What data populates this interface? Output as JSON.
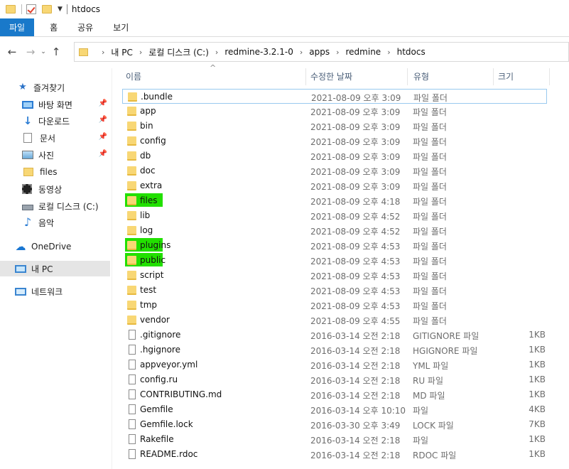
{
  "window": {
    "title": "htdocs"
  },
  "ribbon": {
    "tabs": [
      "파일",
      "홈",
      "공유",
      "보기"
    ]
  },
  "address": {
    "breadcrumbs": [
      "내 PC",
      "로컬 디스크 (C:)",
      "redmine-3.2.1-0",
      "apps",
      "redmine",
      "htdocs"
    ]
  },
  "sidebar": {
    "items": [
      {
        "label": "즐겨찾기",
        "icon": "star-icon",
        "pinned": false
      },
      {
        "label": "바탕 화면",
        "icon": "desktop-icon",
        "pinned": true
      },
      {
        "label": "다운로드",
        "icon": "download-icon",
        "pinned": true
      },
      {
        "label": "문서",
        "icon": "document-icon",
        "pinned": true
      },
      {
        "label": "사진",
        "icon": "pictures-icon",
        "pinned": true
      },
      {
        "label": "files",
        "icon": "folder-icon",
        "pinned": false
      },
      {
        "label": "동영상",
        "icon": "video-icon",
        "pinned": false
      },
      {
        "label": "로컬 디스크 (C:)",
        "icon": "drive-icon",
        "pinned": false
      },
      {
        "label": "음악",
        "icon": "music-icon",
        "pinned": false
      },
      {
        "label": "OneDrive",
        "icon": "onedrive-icon",
        "pinned": false
      },
      {
        "label": "내 PC",
        "icon": "pc-icon",
        "pinned": false,
        "selected": true
      },
      {
        "label": "네트워크",
        "icon": "network-icon",
        "pinned": false
      }
    ]
  },
  "columns": {
    "name": "이름",
    "modified": "수정한 날짜",
    "type": "유형",
    "size": "크기"
  },
  "files": [
    {
      "name": ".bundle",
      "date": "2021-08-09 오후 3:09",
      "type": "파일 폴더",
      "size": "",
      "kind": "folder",
      "focused": true
    },
    {
      "name": "app",
      "date": "2021-08-09 오후 3:09",
      "type": "파일 폴더",
      "size": "",
      "kind": "folder"
    },
    {
      "name": "bin",
      "date": "2021-08-09 오후 3:09",
      "type": "파일 폴더",
      "size": "",
      "kind": "folder"
    },
    {
      "name": "config",
      "date": "2021-08-09 오후 3:09",
      "type": "파일 폴더",
      "size": "",
      "kind": "folder"
    },
    {
      "name": "db",
      "date": "2021-08-09 오후 3:09",
      "type": "파일 폴더",
      "size": "",
      "kind": "folder"
    },
    {
      "name": "doc",
      "date": "2021-08-09 오후 3:09",
      "type": "파일 폴더",
      "size": "",
      "kind": "folder"
    },
    {
      "name": "extra",
      "date": "2021-08-09 오후 3:09",
      "type": "파일 폴더",
      "size": "",
      "kind": "folder"
    },
    {
      "name": "files",
      "date": "2021-08-09 오후 4:18",
      "type": "파일 폴더",
      "size": "",
      "kind": "folder",
      "highlight": true
    },
    {
      "name": "lib",
      "date": "2021-08-09 오후 4:52",
      "type": "파일 폴더",
      "size": "",
      "kind": "folder"
    },
    {
      "name": "log",
      "date": "2021-08-09 오후 4:52",
      "type": "파일 폴더",
      "size": "",
      "kind": "folder"
    },
    {
      "name": "plugins",
      "date": "2021-08-09 오후 4:53",
      "type": "파일 폴더",
      "size": "",
      "kind": "folder",
      "highlight": true
    },
    {
      "name": "public",
      "date": "2021-08-09 오후 4:53",
      "type": "파일 폴더",
      "size": "",
      "kind": "folder",
      "highlight": true
    },
    {
      "name": "script",
      "date": "2021-08-09 오후 4:53",
      "type": "파일 폴더",
      "size": "",
      "kind": "folder"
    },
    {
      "name": "test",
      "date": "2021-08-09 오후 4:53",
      "type": "파일 폴더",
      "size": "",
      "kind": "folder"
    },
    {
      "name": "tmp",
      "date": "2021-08-09 오후 4:53",
      "type": "파일 폴더",
      "size": "",
      "kind": "folder"
    },
    {
      "name": "vendor",
      "date": "2021-08-09 오후 4:55",
      "type": "파일 폴더",
      "size": "",
      "kind": "folder"
    },
    {
      "name": ".gitignore",
      "date": "2016-03-14 오전 2:18",
      "type": "GITIGNORE 파일",
      "size": "1KB",
      "kind": "file"
    },
    {
      "name": ".hgignore",
      "date": "2016-03-14 오전 2:18",
      "type": "HGIGNORE 파일",
      "size": "1KB",
      "kind": "file"
    },
    {
      "name": "appveyor.yml",
      "date": "2016-03-14 오전 2:18",
      "type": "YML 파일",
      "size": "1KB",
      "kind": "file"
    },
    {
      "name": "config.ru",
      "date": "2016-03-14 오전 2:18",
      "type": "RU 파일",
      "size": "1KB",
      "kind": "file"
    },
    {
      "name": "CONTRIBUTING.md",
      "date": "2016-03-14 오전 2:18",
      "type": "MD 파일",
      "size": "1KB",
      "kind": "file"
    },
    {
      "name": "Gemfile",
      "date": "2016-03-14 오후 10:10",
      "type": "파일",
      "size": "4KB",
      "kind": "file"
    },
    {
      "name": "Gemfile.lock",
      "date": "2016-03-30 오후 3:49",
      "type": "LOCK 파일",
      "size": "7KB",
      "kind": "file"
    },
    {
      "name": "Rakefile",
      "date": "2016-03-14 오전 2:18",
      "type": "파일",
      "size": "1KB",
      "kind": "file"
    },
    {
      "name": "README.rdoc",
      "date": "2016-03-14 오전 2:18",
      "type": "RDOC 파일",
      "size": "1KB",
      "kind": "file"
    }
  ],
  "colors": {
    "ribbon_file_tab": "#1979ca",
    "highlight": "#22e000",
    "folder": "#f8d775"
  }
}
